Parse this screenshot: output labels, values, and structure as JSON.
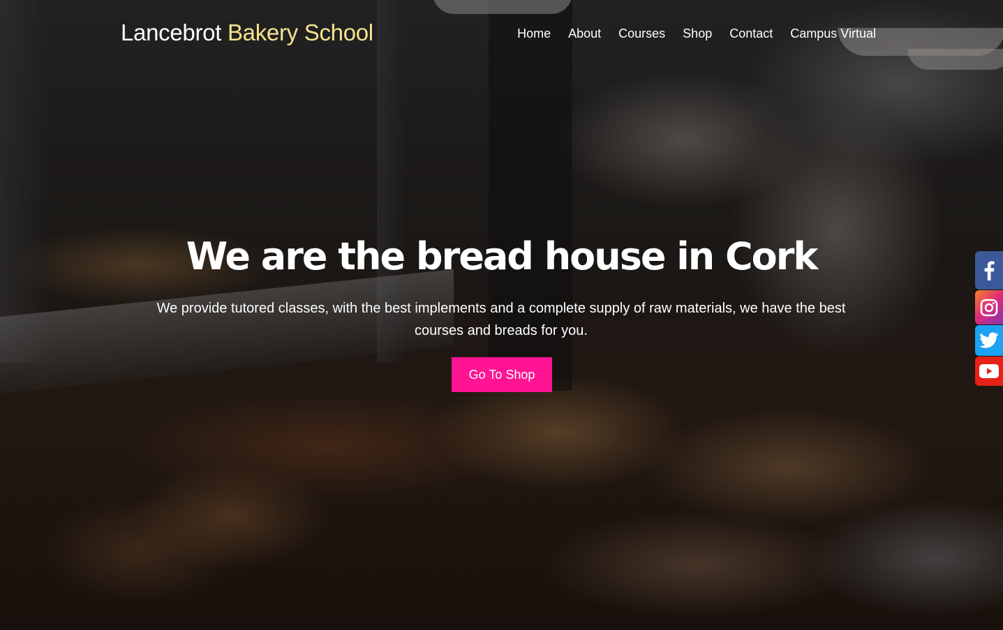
{
  "header": {
    "brand_main": "Lancebrot",
    "brand_accent": "Bakery School",
    "nav": [
      "Home",
      "About",
      "Courses",
      "Shop",
      "Contact",
      "Campus Virtual"
    ]
  },
  "hero": {
    "title": "We are the bread house in Cork",
    "subtitle": "We provide tutored classes, with the best implements and a complete supply of raw materials, we have the best courses and breads for you.",
    "button_label": "Go To Shop"
  },
  "social": [
    "facebook-icon",
    "instagram-icon",
    "twitter-icon",
    "youtube-icon"
  ],
  "colors": {
    "brand_accent": "#f7e38e",
    "button": "#ff1493",
    "facebook": "#3b5998",
    "twitter": "#1da1f2",
    "youtube": "#e62117"
  }
}
